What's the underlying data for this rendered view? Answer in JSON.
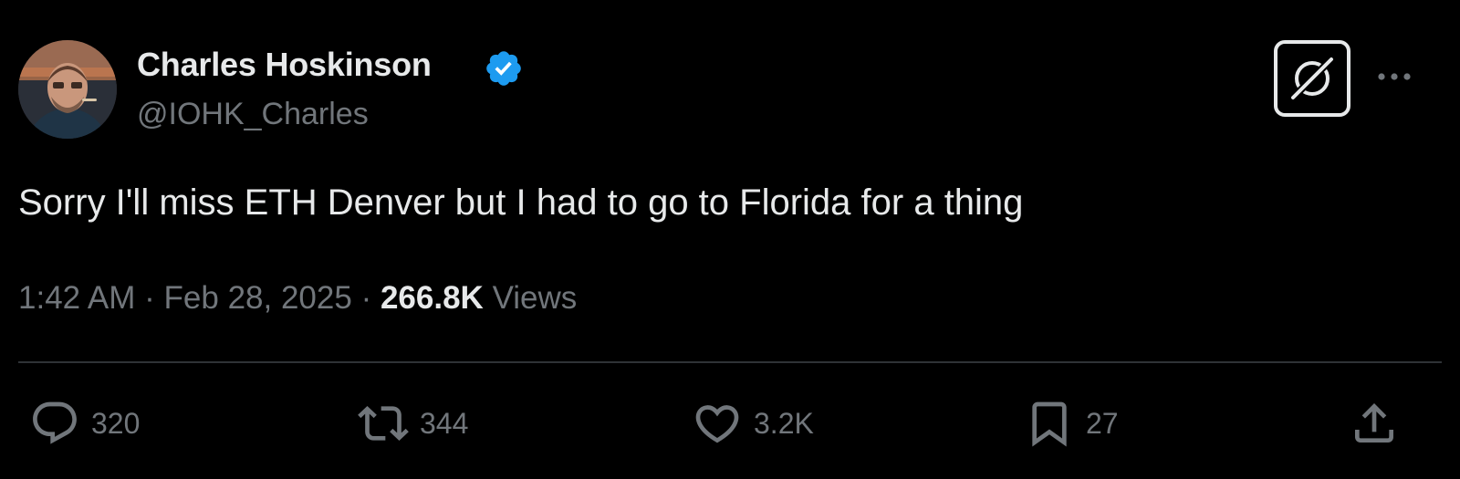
{
  "author": {
    "display_name": "Charles Hoskinson",
    "handle": "@IOHK_Charles",
    "verified": true,
    "verified_color": "#1d9bf0"
  },
  "tweet": {
    "text": "Sorry I'll miss ETH Denver but I had to go to Florida for a thing",
    "time": "1:42 AM",
    "separator": "·",
    "date": "Feb 28, 2025",
    "views_count": "266.8K",
    "views_label": "Views"
  },
  "actions": {
    "replies": "320",
    "reposts": "344",
    "likes": "3.2K",
    "bookmarks": "27"
  },
  "icons": {
    "grok": "grok-icon",
    "more": "more-icon",
    "reply": "reply-icon",
    "repost": "repost-icon",
    "like": "heart-icon",
    "bookmark": "bookmark-icon",
    "share": "share-icon"
  },
  "colors": {
    "background": "#000000",
    "primary_text": "#e7e9ea",
    "secondary_text": "#71767b",
    "divider": "#2f3336"
  }
}
